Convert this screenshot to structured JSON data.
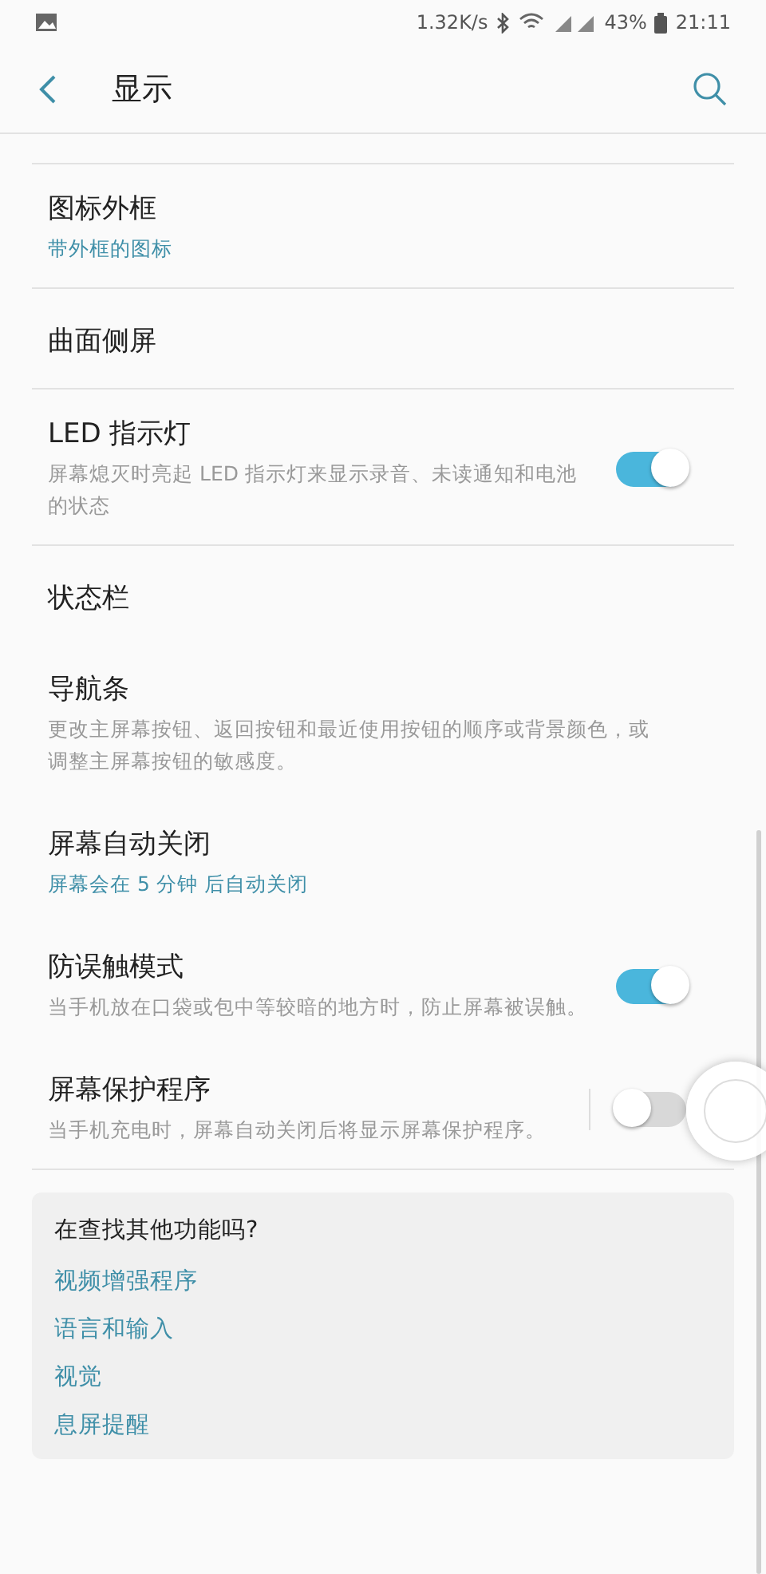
{
  "status_bar": {
    "speed": "1.32K/s",
    "battery": "43%",
    "time": "21:11"
  },
  "header": {
    "title": "显示"
  },
  "items": [
    {
      "title": "图标外框",
      "summary": "带外框的图标",
      "highlighted": true,
      "separator": true
    },
    {
      "title": "曲面侧屏",
      "separator": true
    },
    {
      "title": "LED 指示灯",
      "summary": "屏幕熄灭时亮起 LED 指示灯来显示录音、未读通知和电池的状态",
      "highlighted": false,
      "toggle": {
        "on": true,
        "split": false
      },
      "separator": true
    },
    {
      "title": "状态栏",
      "separator": false
    },
    {
      "title": "导航条",
      "summary": "更改主屏幕按钮、返回按钮和最近使用按钮的顺序或背景颜色，或调整主屏幕按钮的敏感度。",
      "highlighted": false,
      "separator": false
    },
    {
      "title": "屏幕自动关闭",
      "summary": "屏幕会在 5 分钟 后自动关闭",
      "highlighted": true,
      "separator": false
    },
    {
      "title": "防误触模式",
      "summary": "当手机放在口袋或包中等较暗的地方时，防止屏幕被误触。",
      "highlighted": false,
      "toggle": {
        "on": true,
        "split": false
      },
      "separator": false
    },
    {
      "title": "屏幕保护程序",
      "summary": "当手机充电时，屏幕自动关闭后将显示屏幕保护程序。",
      "highlighted": false,
      "toggle": {
        "on": false,
        "split": true
      },
      "separator": true
    }
  ],
  "suggestions": {
    "title": "在查找其他功能吗?",
    "links": [
      "视频增强程序",
      "语言和输入",
      "视觉",
      "息屏提醒"
    ]
  }
}
